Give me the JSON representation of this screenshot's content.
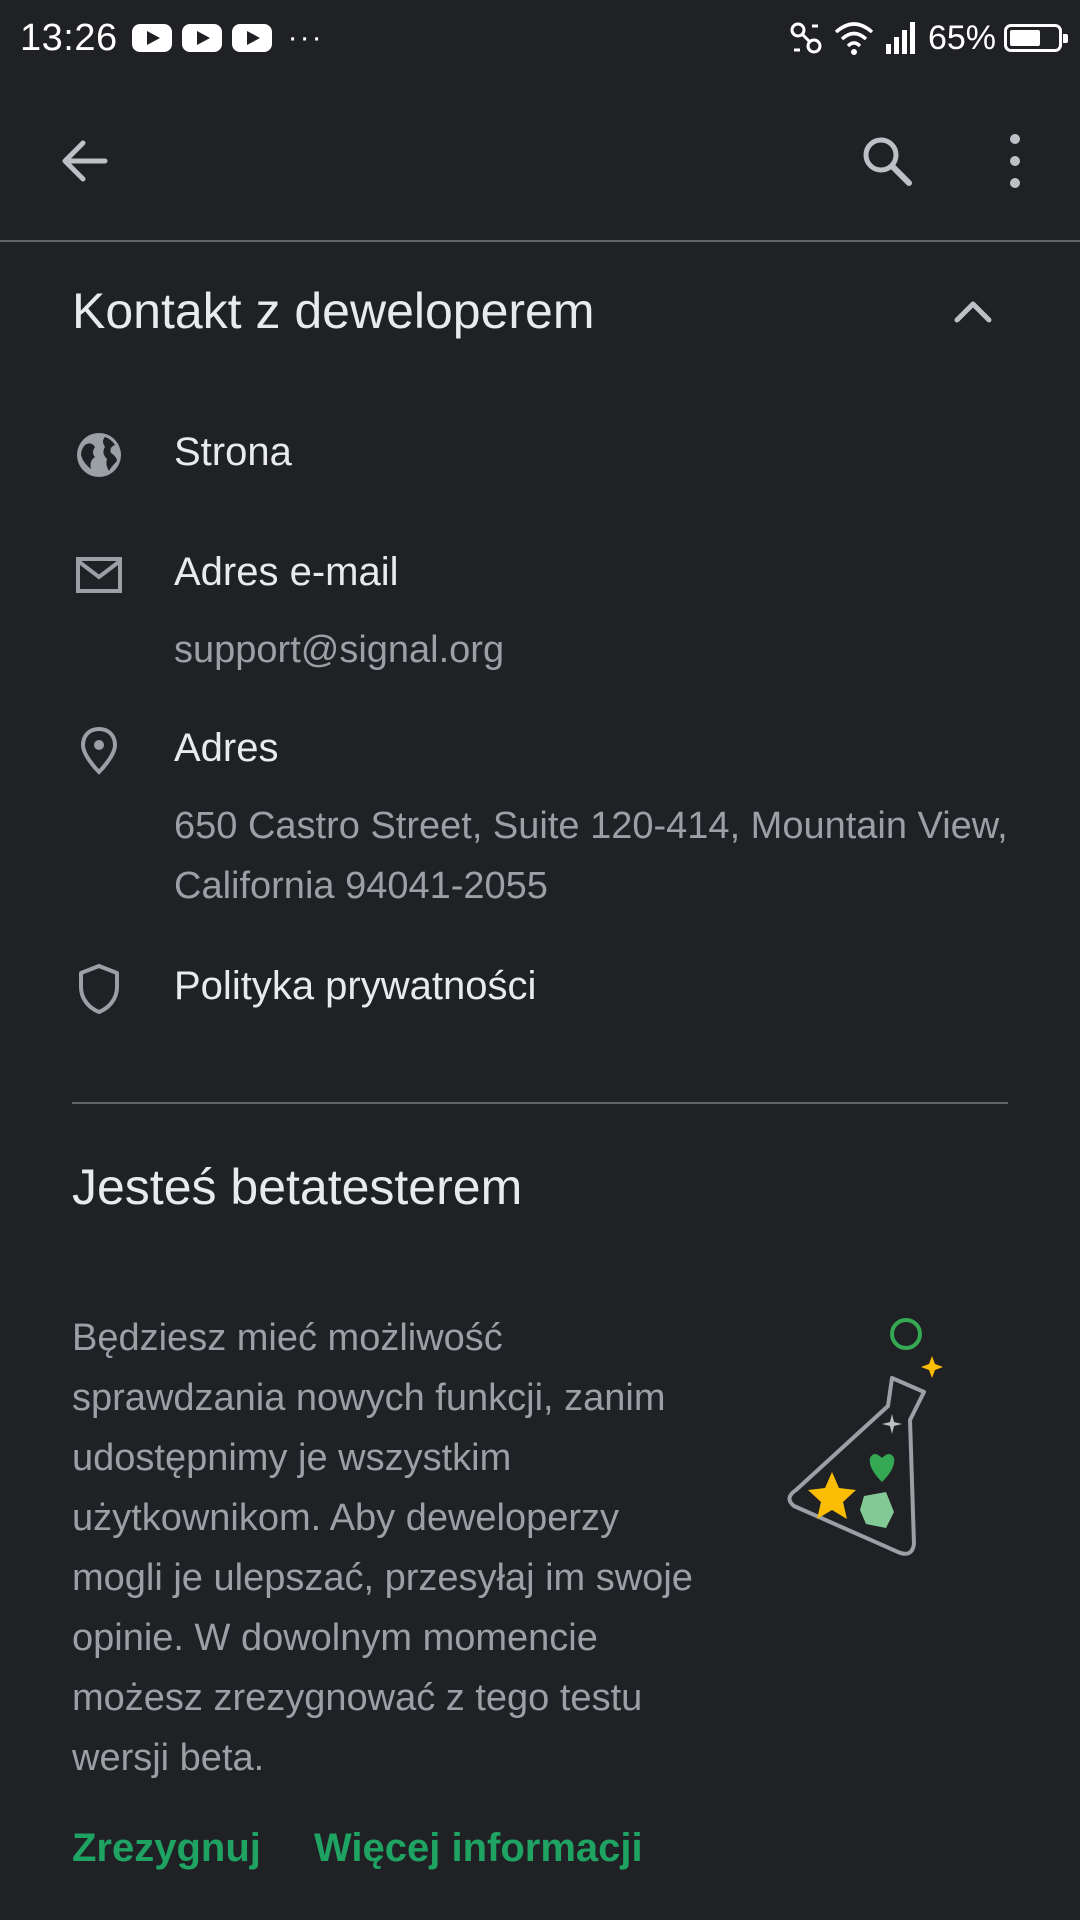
{
  "status_bar": {
    "time": "13:26",
    "notification_icons": [
      "youtube-icon",
      "youtube-icon",
      "youtube-icon"
    ],
    "overflow": "···",
    "battery_percent_text": "65%",
    "battery_level": 0.65
  },
  "app_bar": {
    "back_icon": "arrow-back-icon",
    "search_icon": "search-icon",
    "menu_icon": "more-vert-icon"
  },
  "developer_contact": {
    "title": "Kontakt z deweloperem",
    "items": [
      {
        "icon": "globe-icon",
        "label": "Strona"
      },
      {
        "icon": "mail-icon",
        "label": "Adres e-mail",
        "value": "support@signal.org"
      },
      {
        "icon": "location-pin-icon",
        "label": "Adres",
        "value": "650 Castro Street, Suite 120-414, Mountain View, California 94041-2055"
      },
      {
        "icon": "shield-icon",
        "label": "Polityka prywatności"
      }
    ]
  },
  "beta": {
    "title": "Jesteś betatesterem",
    "description": "Będziesz mieć możliwość sprawdzania nowych funkcji, zanim udostępnimy je wszystkim użytkownikom. Aby deweloperzy mogli je ulepszać, przesyłaj im swoje opinie. W dowolnym momencie możesz zrezygnować z tego testu wersji beta.",
    "leave_label": "Zrezygnuj",
    "more_info_label": "Więcej informacji"
  },
  "colors": {
    "background": "#202124",
    "text_primary": "#e8eaed",
    "text_secondary": "#9aa0a6",
    "accent_link": "#1ea362"
  }
}
